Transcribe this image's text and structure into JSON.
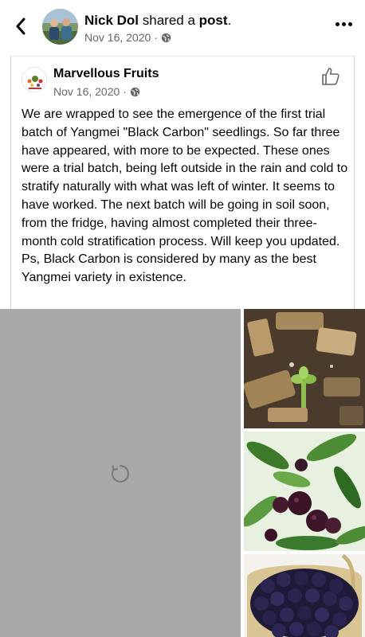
{
  "header": {
    "sharer_name": "Nick Dol",
    "action_text": " shared a ",
    "object_text": "post",
    "period": ".",
    "date": "Nov 16, 2020",
    "separator": "·",
    "back_icon": "chevron-left-icon",
    "more_icon": "more-options-icon",
    "privacy_icon": "globe-icon"
  },
  "post": {
    "page_name": "Marvellous Fruits",
    "date": "Nov 16, 2020",
    "separator": "·",
    "privacy_icon": "globe-icon",
    "like_icon": "thumbs-up-icon",
    "text": "We are wrapped to see the emergence of the first trial batch of Yangmei \"Black Carbon\" seedlings. So far three have appeared, with more to be expected. These ones were a trial batch, being left outside in the rain and cold to stratify naturally with what was left of winter. It seems to have worked. The next batch will be going in soil soon, from the fridge, having almost completed their three-month cold stratification process. Will keep you updated. Ps, Black Carbon is considered by many as the best Yangmei variety in existence."
  },
  "media": {
    "loading_icon": "loading-spinner-icon",
    "photos": [
      "seedling-in-mulch-photo",
      "yangmei-fruit-on-tree-photo",
      "basket-of-yangmei-photo"
    ]
  },
  "colors": {
    "secondary_text": "#65676b",
    "card_border": "#cfd1d4",
    "placeholder": "#a9a9ac"
  }
}
